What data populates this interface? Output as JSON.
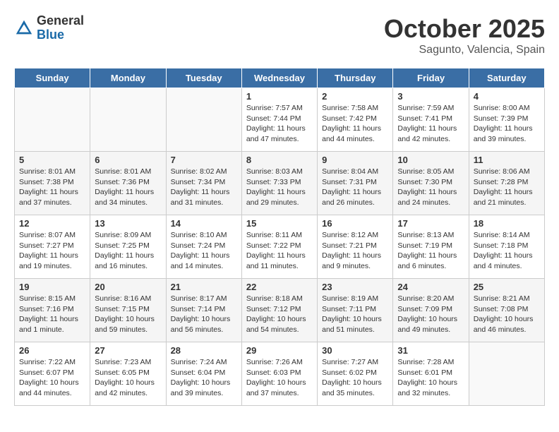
{
  "header": {
    "logo_general": "General",
    "logo_blue": "Blue",
    "month_title": "October 2025",
    "location": "Sagunto, Valencia, Spain"
  },
  "days_of_week": [
    "Sunday",
    "Monday",
    "Tuesday",
    "Wednesday",
    "Thursday",
    "Friday",
    "Saturday"
  ],
  "weeks": [
    [
      {
        "day": "",
        "info": ""
      },
      {
        "day": "",
        "info": ""
      },
      {
        "day": "",
        "info": ""
      },
      {
        "day": "1",
        "info": "Sunrise: 7:57 AM\nSunset: 7:44 PM\nDaylight: 11 hours\nand 47 minutes."
      },
      {
        "day": "2",
        "info": "Sunrise: 7:58 AM\nSunset: 7:42 PM\nDaylight: 11 hours\nand 44 minutes."
      },
      {
        "day": "3",
        "info": "Sunrise: 7:59 AM\nSunset: 7:41 PM\nDaylight: 11 hours\nand 42 minutes."
      },
      {
        "day": "4",
        "info": "Sunrise: 8:00 AM\nSunset: 7:39 PM\nDaylight: 11 hours\nand 39 minutes."
      }
    ],
    [
      {
        "day": "5",
        "info": "Sunrise: 8:01 AM\nSunset: 7:38 PM\nDaylight: 11 hours\nand 37 minutes."
      },
      {
        "day": "6",
        "info": "Sunrise: 8:01 AM\nSunset: 7:36 PM\nDaylight: 11 hours\nand 34 minutes."
      },
      {
        "day": "7",
        "info": "Sunrise: 8:02 AM\nSunset: 7:34 PM\nDaylight: 11 hours\nand 31 minutes."
      },
      {
        "day": "8",
        "info": "Sunrise: 8:03 AM\nSunset: 7:33 PM\nDaylight: 11 hours\nand 29 minutes."
      },
      {
        "day": "9",
        "info": "Sunrise: 8:04 AM\nSunset: 7:31 PM\nDaylight: 11 hours\nand 26 minutes."
      },
      {
        "day": "10",
        "info": "Sunrise: 8:05 AM\nSunset: 7:30 PM\nDaylight: 11 hours\nand 24 minutes."
      },
      {
        "day": "11",
        "info": "Sunrise: 8:06 AM\nSunset: 7:28 PM\nDaylight: 11 hours\nand 21 minutes."
      }
    ],
    [
      {
        "day": "12",
        "info": "Sunrise: 8:07 AM\nSunset: 7:27 PM\nDaylight: 11 hours\nand 19 minutes."
      },
      {
        "day": "13",
        "info": "Sunrise: 8:09 AM\nSunset: 7:25 PM\nDaylight: 11 hours\nand 16 minutes."
      },
      {
        "day": "14",
        "info": "Sunrise: 8:10 AM\nSunset: 7:24 PM\nDaylight: 11 hours\nand 14 minutes."
      },
      {
        "day": "15",
        "info": "Sunrise: 8:11 AM\nSunset: 7:22 PM\nDaylight: 11 hours\nand 11 minutes."
      },
      {
        "day": "16",
        "info": "Sunrise: 8:12 AM\nSunset: 7:21 PM\nDaylight: 11 hours\nand 9 minutes."
      },
      {
        "day": "17",
        "info": "Sunrise: 8:13 AM\nSunset: 7:19 PM\nDaylight: 11 hours\nand 6 minutes."
      },
      {
        "day": "18",
        "info": "Sunrise: 8:14 AM\nSunset: 7:18 PM\nDaylight: 11 hours\nand 4 minutes."
      }
    ],
    [
      {
        "day": "19",
        "info": "Sunrise: 8:15 AM\nSunset: 7:16 PM\nDaylight: 11 hours\nand 1 minute."
      },
      {
        "day": "20",
        "info": "Sunrise: 8:16 AM\nSunset: 7:15 PM\nDaylight: 10 hours\nand 59 minutes."
      },
      {
        "day": "21",
        "info": "Sunrise: 8:17 AM\nSunset: 7:14 PM\nDaylight: 10 hours\nand 56 minutes."
      },
      {
        "day": "22",
        "info": "Sunrise: 8:18 AM\nSunset: 7:12 PM\nDaylight: 10 hours\nand 54 minutes."
      },
      {
        "day": "23",
        "info": "Sunrise: 8:19 AM\nSunset: 7:11 PM\nDaylight: 10 hours\nand 51 minutes."
      },
      {
        "day": "24",
        "info": "Sunrise: 8:20 AM\nSunset: 7:09 PM\nDaylight: 10 hours\nand 49 minutes."
      },
      {
        "day": "25",
        "info": "Sunrise: 8:21 AM\nSunset: 7:08 PM\nDaylight: 10 hours\nand 46 minutes."
      }
    ],
    [
      {
        "day": "26",
        "info": "Sunrise: 7:22 AM\nSunset: 6:07 PM\nDaylight: 10 hours\nand 44 minutes."
      },
      {
        "day": "27",
        "info": "Sunrise: 7:23 AM\nSunset: 6:05 PM\nDaylight: 10 hours\nand 42 minutes."
      },
      {
        "day": "28",
        "info": "Sunrise: 7:24 AM\nSunset: 6:04 PM\nDaylight: 10 hours\nand 39 minutes."
      },
      {
        "day": "29",
        "info": "Sunrise: 7:26 AM\nSunset: 6:03 PM\nDaylight: 10 hours\nand 37 minutes."
      },
      {
        "day": "30",
        "info": "Sunrise: 7:27 AM\nSunset: 6:02 PM\nDaylight: 10 hours\nand 35 minutes."
      },
      {
        "day": "31",
        "info": "Sunrise: 7:28 AM\nSunset: 6:01 PM\nDaylight: 10 hours\nand 32 minutes."
      },
      {
        "day": "",
        "info": ""
      }
    ]
  ]
}
